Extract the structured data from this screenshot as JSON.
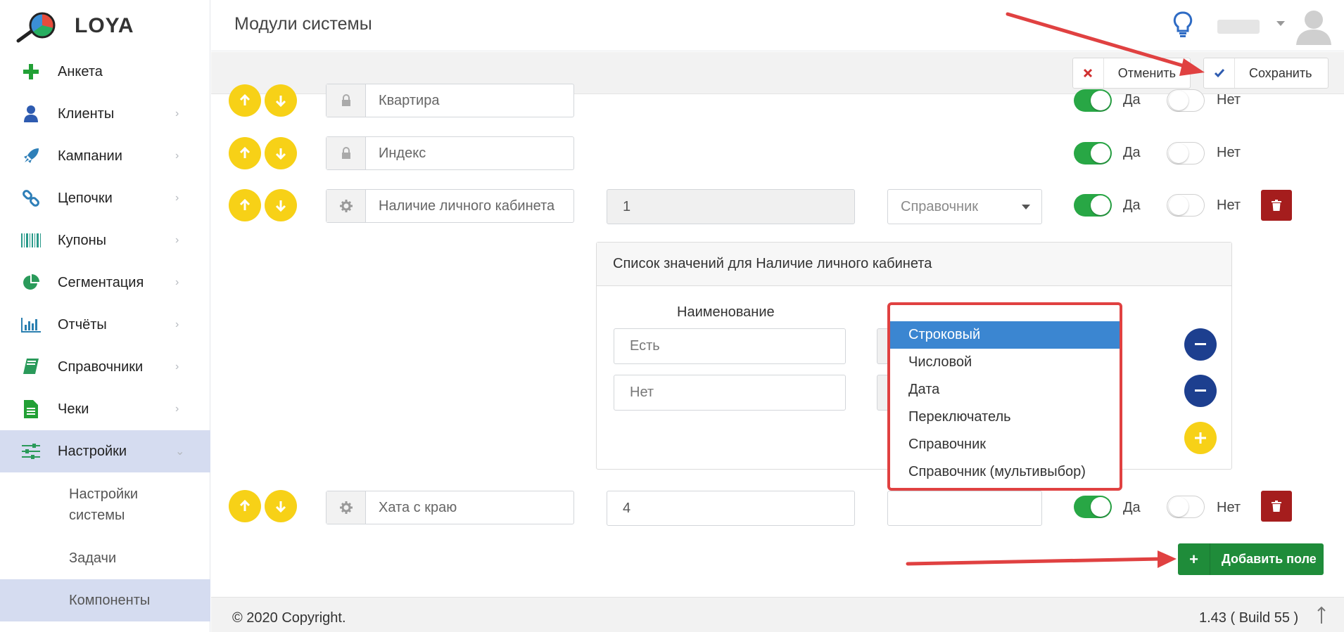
{
  "app": {
    "logo_text": "LOYA"
  },
  "header": {
    "title": "Модули системы"
  },
  "sidebar": {
    "items": [
      {
        "label": "Анкета",
        "icon": "plus-icon"
      },
      {
        "label": "Клиенты",
        "icon": "user-icon"
      },
      {
        "label": "Кампании",
        "icon": "rocket-icon"
      },
      {
        "label": "Цепочки",
        "icon": "link-icon"
      },
      {
        "label": "Купоны",
        "icon": "barcode-icon"
      },
      {
        "label": "Сегментация",
        "icon": "pie-chart-icon"
      },
      {
        "label": "Отчёты",
        "icon": "bar-chart-icon"
      },
      {
        "label": "Справочники",
        "icon": "book-icon"
      },
      {
        "label": "Чеки",
        "icon": "document-icon"
      },
      {
        "label": "Настройки",
        "icon": "sliders-icon"
      }
    ],
    "subitems": [
      {
        "label": "Настройки системы"
      },
      {
        "label": "Задачи"
      },
      {
        "label": "Компоненты"
      }
    ]
  },
  "toolbar": {
    "cancel_label": "Отменить",
    "save_label": "Сохранить"
  },
  "rows": [
    {
      "name": "Квартира",
      "yes": "Да",
      "no": "Нет"
    },
    {
      "name": "Индекс",
      "yes": "Да",
      "no": "Нет"
    },
    {
      "name": "Наличие личного кабинета",
      "number": "1",
      "type": "Справочник",
      "yes": "Да",
      "no": "Нет"
    },
    {
      "name": "Хата с краю",
      "number": "4",
      "yes": "Да",
      "no": "Нет"
    }
  ],
  "panel": {
    "title": "Список значений для Наличие личного кабинета",
    "column_header": "Наименование",
    "values": [
      "Есть",
      "Нет"
    ]
  },
  "dropdown": {
    "options": [
      "Строковый",
      "Числовой",
      "Дата",
      "Переключатель",
      "Справочник",
      "Справочник (мультивыбор)"
    ],
    "selected": "Строковый"
  },
  "add_field_label": "Добавить поле",
  "footer": {
    "copyright": "© 2020 Copyright.",
    "version": "1.43 ( Build 55 )"
  },
  "colors": {
    "accent_yellow": "#f7d117",
    "success_green": "#28a745",
    "danger_red": "#a51d1d",
    "navy": "#1d3f8f",
    "annotation_red": "#e04141"
  }
}
